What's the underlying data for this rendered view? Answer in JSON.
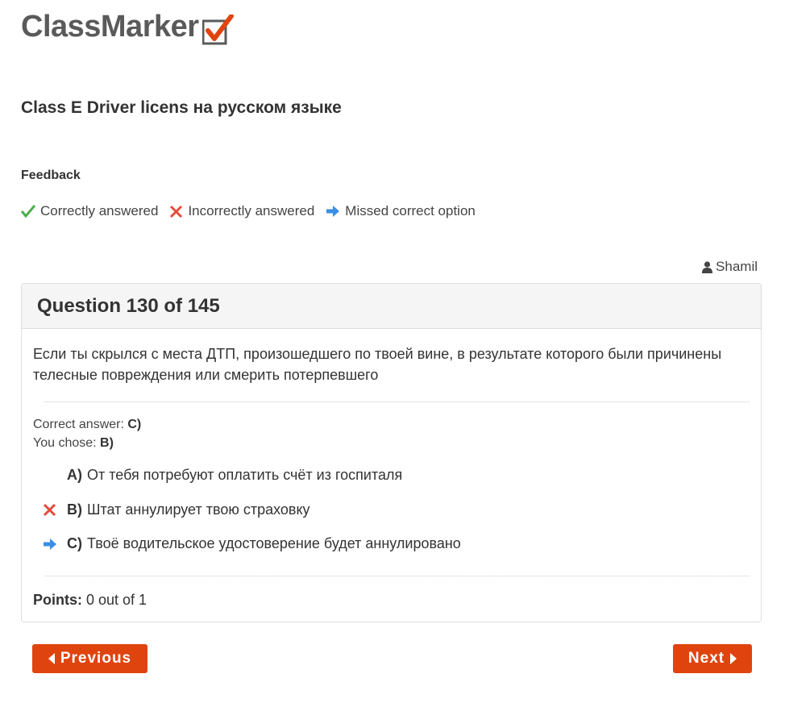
{
  "brand": {
    "logo_text": "ClassMarker"
  },
  "quiz": {
    "title": "Class E Driver licens на русском языке"
  },
  "feedback": {
    "heading": "Feedback",
    "legend": {
      "correct": "Correctly answered",
      "incorrect": "Incorrectly answered",
      "missed": "Missed correct option"
    }
  },
  "user": {
    "name": "Shamil"
  },
  "question": {
    "header": "Question 130 of 145",
    "text": "Если ты скрылся с места ДТП, произошедшего по твоей вине, в результате которого были причинены телесные повреждения или смерить потерпевшего",
    "correct_answer_label": "Correct answer: ",
    "correct_answer_value": "C)",
    "you_chose_label": "You chose: ",
    "you_chose_value": "B)",
    "options": [
      {
        "letter": "A)",
        "text": "От тебя потребуют оплатить счёт из госпиталя",
        "mark": ""
      },
      {
        "letter": "B)",
        "text": "Штат аннулирует твою страховку",
        "mark": "x-icon"
      },
      {
        "letter": "C)",
        "text": "Твоё водительское удостоверение будет аннулировано",
        "mark": "arrow-right-icon"
      }
    ],
    "points_label": "Points:",
    "points_value": " 0 out of 1"
  },
  "nav": {
    "previous_label": "Previous",
    "next_label": "Next"
  },
  "colors": {
    "accent": "#e0440e",
    "correct": "#4cae4c",
    "incorrect": "#e74c3c",
    "missed": "#3a8ee6"
  }
}
